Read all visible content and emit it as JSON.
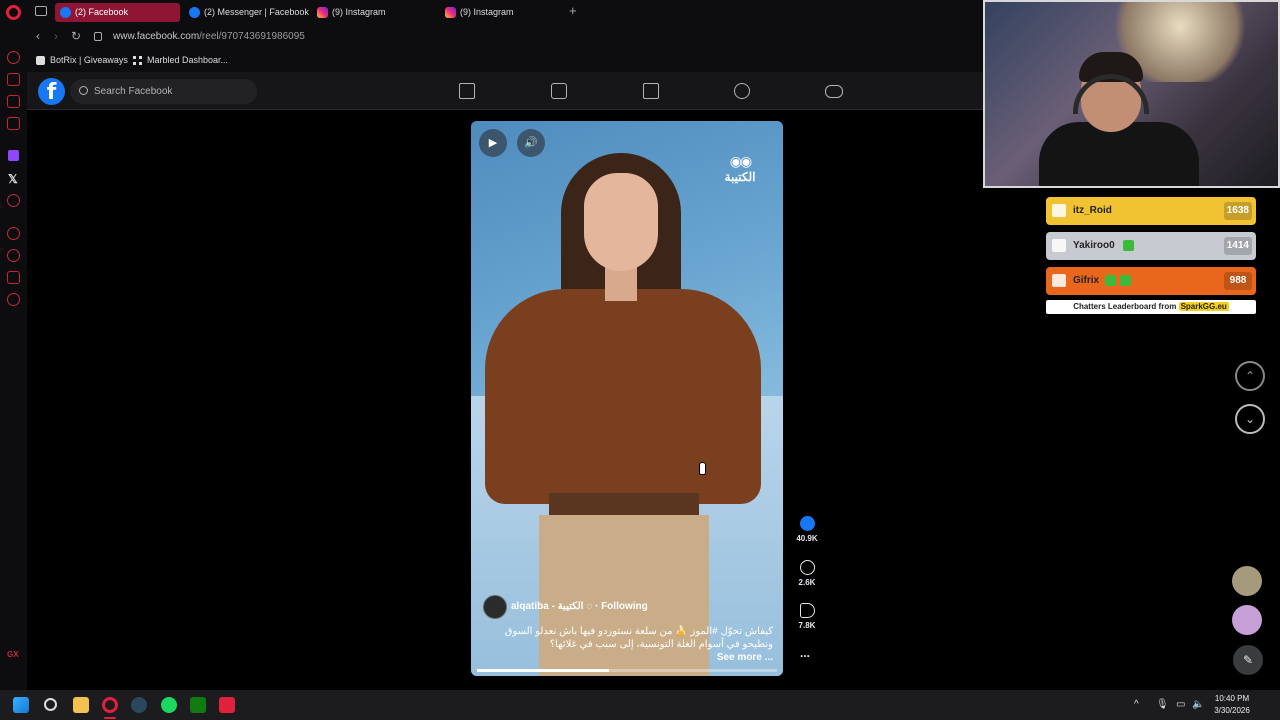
{
  "browser": {
    "tabs": [
      {
        "label": "(2) Facebook",
        "favicon": "facebook-icon",
        "active": true
      },
      {
        "label": "(2) Messenger | Facebook",
        "favicon": "facebook-icon",
        "active": false
      },
      {
        "label": "(9) Instagram",
        "favicon": "instagram-icon",
        "active": false
      },
      {
        "label": "(9) Instagram",
        "favicon": "instagram-icon",
        "active": false
      }
    ],
    "new_tab": "+",
    "url_host": "www.facebook.com",
    "url_path": "/reel/970743691986095",
    "bookmarks": [
      {
        "label": "BotRix | Giveaways"
      },
      {
        "label": "Marbled Dashboar..."
      }
    ],
    "sidebar_label": "GX"
  },
  "facebook": {
    "logo": "f",
    "search_placeholder": "Search Facebook",
    "nav_icons": [
      "home-icon",
      "reels-icon",
      "marketplace-icon",
      "groups-icon",
      "gaming-icon"
    ]
  },
  "reel": {
    "brand_mark": "الكتيبة",
    "author_handle": "alqatiba",
    "author_name": "الكتيبة",
    "following": "· Following",
    "caption_line1": "كيفاش تحوّل #الموز 🍌 من سلعة نستوردو فيها باش نعدلو السوق",
    "caption_line2": "ونطيحو في أسوام الغلة التونسية، إلى سبب في غلائها؟",
    "see_more": "See more ...",
    "progress_fraction": 0.44,
    "likes": "40.9K",
    "comments": "2.6K",
    "shares": "7.8K",
    "more": "..."
  },
  "leaderboard": {
    "entries": [
      {
        "name": "itz_Roid",
        "score": "1638",
        "color": "#f1c232"
      },
      {
        "name": "Yakiroo0",
        "score": "1414",
        "color": "#c7cbd1"
      },
      {
        "name": "Gifrix",
        "score": "988",
        "color": "#e8671c"
      }
    ],
    "footer_text": "Chatters Leaderboard from",
    "footer_brand": "SparkGG.eu"
  },
  "overlay_controls": {
    "up": "⌃",
    "down": "⌄",
    "edit": "✎"
  },
  "taskbar": {
    "time": "10:40 PM",
    "date": "3/30/2026",
    "tray_up": "^"
  }
}
